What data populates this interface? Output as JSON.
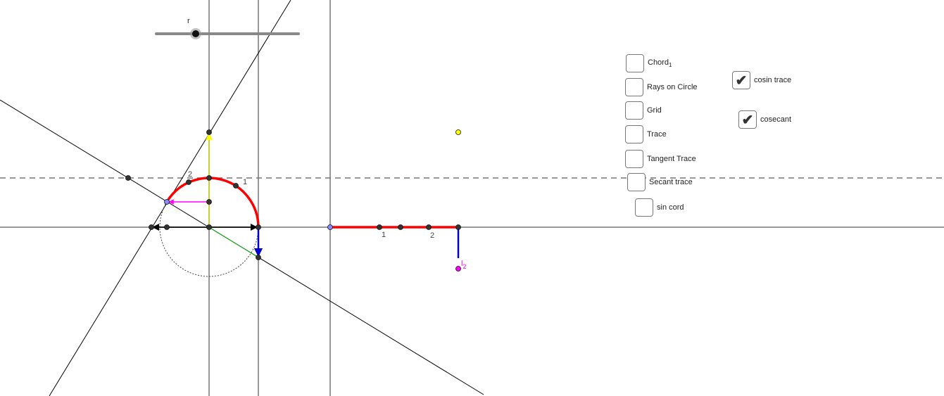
{
  "slider": {
    "label": "r",
    "value_fraction": 0.28
  },
  "canvas_labels": {
    "arc_label_2": "2",
    "arc_label_1": "1",
    "axis_label_1": "1",
    "axis_label_2": "2",
    "point_label": "l",
    "point_label_sub": "2"
  },
  "checkboxes": [
    {
      "label": "Chord",
      "sub": "1",
      "checked": false
    },
    {
      "label": "Rays on Circle",
      "checked": false
    },
    {
      "label": "Grid",
      "checked": false
    },
    {
      "label": "Trace",
      "checked": false
    },
    {
      "label": "Tangent Trace",
      "checked": false
    },
    {
      "label": "Secant trace",
      "checked": false
    },
    {
      "label": "sin cord",
      "checked": false
    },
    {
      "label": "cosin trace",
      "checked": true
    },
    {
      "label": "cosecant",
      "checked": true
    }
  ],
  "check_glyph": "✔",
  "colors": {
    "red": "#ff0000",
    "yellow": "#ffff00",
    "magenta": "#ff00ff",
    "blue": "#0000cc",
    "green": "#00bb00"
  }
}
